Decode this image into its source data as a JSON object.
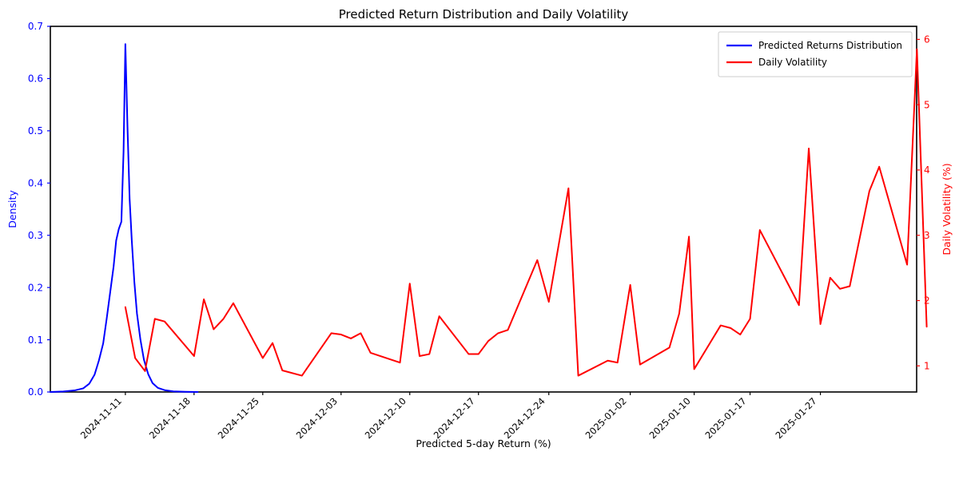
{
  "chart_data": {
    "type": "line",
    "title": "Predicted Return Distribution and Daily Volatility",
    "xlabel": "Predicted 5-day Return (%)",
    "ylabel": "Density",
    "ylabel_right": "Daily Volatility (%)",
    "grid": false,
    "legend_position": "upper right",
    "ylim": [
      0.0,
      0.7
    ],
    "ylim_right": [
      0.6,
      6.2
    ],
    "yticks": [
      0.0,
      0.1,
      0.2,
      0.3,
      0.4,
      0.5,
      0.6,
      0.7
    ],
    "ytick_labels": [
      "0.0",
      "0.1",
      "0.2",
      "0.3",
      "0.4",
      "0.5",
      "0.6",
      "0.7"
    ],
    "yticks_right": [
      1,
      2,
      3,
      4,
      5,
      6
    ],
    "ytick_labels_right": [
      "1",
      "2",
      "3",
      "4",
      "5",
      "6"
    ],
    "xtick_labels": [
      "2024-11-11",
      "2024-11-18",
      "2024-11-25",
      "2024-12-03",
      "2024-12-10",
      "2024-12-17",
      "2024-12-24",
      "2025-01-02",
      "2025-01-10",
      "2025-01-17",
      "2025-01-27"
    ],
    "xtick_positions": [
      0.0866,
      0.1659,
      0.2452,
      0.3356,
      0.4149,
      0.4942,
      0.5754,
      0.6694,
      0.7432,
      0.8077,
      0.8889
    ],
    "xtick_rotation": 45,
    "series": [
      {
        "name": "Predicted Returns Distribution",
        "color": "#0000ff",
        "axis": "left",
        "linewidth": 2.0,
        "x": [
          0.0,
          0.015,
          0.028,
          0.038,
          0.045,
          0.051,
          0.056,
          0.061,
          0.065,
          0.069,
          0.073,
          0.076,
          0.079,
          0.082,
          0.0845,
          0.0866,
          0.089,
          0.0915,
          0.094,
          0.097,
          0.1,
          0.104,
          0.108,
          0.113,
          0.118,
          0.124,
          0.132,
          0.142,
          0.156,
          0.17
        ],
        "y": [
          0.0,
          0.001,
          0.003,
          0.007,
          0.016,
          0.033,
          0.06,
          0.093,
          0.14,
          0.19,
          0.24,
          0.29,
          0.312,
          0.326,
          0.46,
          0.666,
          0.51,
          0.37,
          0.29,
          0.21,
          0.15,
          0.1,
          0.062,
          0.034,
          0.017,
          0.008,
          0.0035,
          0.0012,
          0.0004,
          0.0
        ]
      },
      {
        "name": "Daily Volatility",
        "color": "#ff0000",
        "axis": "right",
        "linewidth": 2.0,
        "dates": [
          "2024-11-11",
          "2024-11-12",
          "2024-11-13",
          "2024-11-14",
          "2024-11-15",
          "2024-11-18",
          "2024-11-19",
          "2024-11-20",
          "2024-11-21",
          "2024-11-22",
          "2024-11-25",
          "2024-11-26",
          "2024-11-27",
          "2024-11-29",
          "2024-12-02",
          "2024-12-03",
          "2024-12-04",
          "2024-12-05",
          "2024-12-06",
          "2024-12-09",
          "2024-12-10",
          "2024-12-11",
          "2024-12-12",
          "2024-12-13",
          "2024-12-16",
          "2024-12-17",
          "2024-12-18",
          "2024-12-19",
          "2024-12-20",
          "2024-12-23",
          "2024-12-24",
          "2024-12-26",
          "2024-12-27",
          "2024-12-30",
          "2024-12-31",
          "2025-01-02",
          "2025-01-03",
          "2025-01-06",
          "2025-01-07",
          "2025-01-08",
          "2025-01-10",
          "2025-01-13",
          "2025-01-14",
          "2025-01-15",
          "2025-01-16",
          "2025-01-17",
          "2025-01-21",
          "2025-01-22",
          "2025-01-23",
          "2025-01-24",
          "2025-01-27",
          "2025-01-28",
          "2025-01-29",
          "2025-01-30",
          "2025-01-31",
          "2025-02-03"
        ],
        "x": [
          0.0866,
          0.0979,
          0.1093,
          0.1206,
          0.1319,
          0.1659,
          0.1772,
          0.1885,
          0.1998,
          0.2112,
          0.2452,
          0.2565,
          0.2678,
          0.2904,
          0.3243,
          0.3356,
          0.3469,
          0.3583,
          0.3696,
          0.4036,
          0.4149,
          0.4262,
          0.4375,
          0.4489,
          0.4829,
          0.4942,
          0.5055,
          0.5168,
          0.5281,
          0.5621,
          0.5754,
          0.5981,
          0.6094,
          0.6434,
          0.6547,
          0.6694,
          0.6807,
          0.7146,
          0.7259,
          0.7372,
          0.7432,
          0.7738,
          0.7851,
          0.7964,
          0.8077,
          0.819,
          0.8529,
          0.8642,
          0.8755,
          0.8889,
          0.9002,
          0.9115,
          0.9228,
          0.9455,
          0.9568,
          0.989
        ],
        "values": [
          1.9,
          1.12,
          0.92,
          1.72,
          1.68,
          1.15,
          2.02,
          1.56,
          1.72,
          1.96,
          1.12,
          1.35,
          0.93,
          0.85,
          1.5,
          1.48,
          1.42,
          1.5,
          1.2,
          1.05,
          2.26,
          1.15,
          1.18,
          1.76,
          1.18,
          1.18,
          1.38,
          1.5,
          1.55,
          2.62,
          1.98,
          3.72,
          0.85,
          1.08,
          1.05,
          2.24,
          1.02,
          1.28,
          1.8,
          2.98,
          0.95,
          1.62,
          1.58,
          1.48,
          1.72,
          3.08,
          2.22,
          1.93,
          4.33,
          1.64,
          2.35,
          2.18,
          2.22,
          3.68,
          4.05,
          2.55
        ],
        "peak_value": 5.85,
        "peak_date": "2025-02-03"
      }
    ],
    "volatility_full_values": [
      1.9,
      1.12,
      0.92,
      1.72,
      1.68,
      1.15,
      2.02,
      1.56,
      1.72,
      1.96,
      1.12,
      1.35,
      0.93,
      0.85,
      1.5,
      1.48,
      1.42,
      1.5,
      1.2,
      1.05,
      2.26,
      1.15,
      1.18,
      1.76,
      1.18,
      1.18,
      1.38,
      1.5,
      1.55,
      2.62,
      1.98,
      3.72,
      0.85,
      1.08,
      1.05,
      2.24,
      1.02,
      1.28,
      1.8,
      2.98,
      0.95,
      1.62,
      1.58,
      1.48,
      1.72,
      3.08,
      2.22,
      1.93,
      4.33,
      1.64,
      2.35,
      2.18,
      2.22,
      3.68,
      4.05,
      2.55,
      5.85,
      1.6
    ]
  },
  "legend": {
    "entries": [
      {
        "label": "Predicted Returns Distribution",
        "color": "#0000ff"
      },
      {
        "label": "Daily Volatility",
        "color": "#ff0000"
      }
    ]
  },
  "colors": {
    "density_series": "#0000ff",
    "volatility_series": "#ff0000",
    "axis": "#000000",
    "background": "#ffffff"
  }
}
